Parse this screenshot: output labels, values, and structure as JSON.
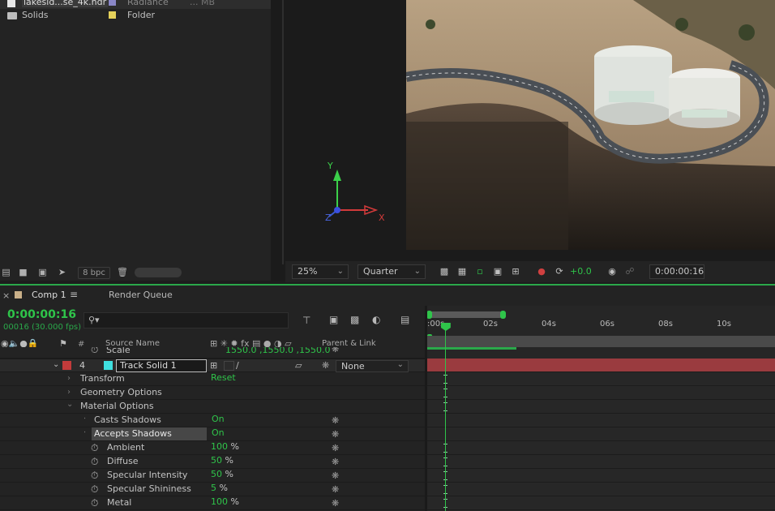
{
  "project": {
    "items": [
      {
        "name": "lakesid...se_4k.hdr",
        "type": "Radiance",
        "size": "... MB",
        "label_color": "#8a87c7"
      },
      {
        "name": "Solids",
        "type": "Folder",
        "size": "",
        "label_color": "#e5d15a"
      }
    ],
    "bpc": "8 bpc"
  },
  "viewer": {
    "magnification": "25%",
    "resolution": "Quarter",
    "exposure": "+0.0",
    "timecode": "0:00:00:16",
    "axes": {
      "x": "X",
      "y": "Y",
      "z": "Z"
    }
  },
  "timeline": {
    "tabs": [
      {
        "label": "Comp 1",
        "active": true
      },
      {
        "label": "Render Queue",
        "active": false
      }
    ],
    "current_time": "0:00:00:16",
    "frame_info": "00016 (30.000 fps)",
    "search_placeholder": "",
    "columns": {
      "num": "#",
      "source_name": "Source Name",
      "parent_link": "Parent & Link"
    },
    "ruler_ticks": [
      ":00s",
      "02s",
      "04s",
      "06s",
      "08s",
      "10s"
    ],
    "playhead_fraction": 0.0533,
    "scale_row": {
      "label": "Scale",
      "value": "1550.0 ,1550.0 ,1550.0"
    },
    "layer": {
      "number": "4",
      "name": "Track Solid 1",
      "parent": "None",
      "label_color": "#c33b3b",
      "swatch_color": "#3fe0e0"
    },
    "groups": [
      {
        "label": "Transform",
        "value": "Reset"
      },
      {
        "label": "Geometry Options",
        "value": ""
      },
      {
        "label": "Material Options",
        "value": ""
      }
    ],
    "properties": [
      {
        "label": "Casts Shadows",
        "value": "On",
        "unit": "",
        "stopwatch": false,
        "selected": false
      },
      {
        "label": "Accepts Shadows",
        "value": "On",
        "unit": "",
        "stopwatch": false,
        "selected": true
      },
      {
        "label": "Ambient",
        "value": "100",
        "unit": "%",
        "stopwatch": true,
        "selected": false
      },
      {
        "label": "Diffuse",
        "value": "50",
        "unit": "%",
        "stopwatch": true,
        "selected": false
      },
      {
        "label": "Specular Intensity",
        "value": "50",
        "unit": "%",
        "stopwatch": true,
        "selected": false
      },
      {
        "label": "Specular Shininess",
        "value": "5",
        "unit": "%",
        "stopwatch": true,
        "selected": false
      },
      {
        "label": "Metal",
        "value": "100",
        "unit": "%",
        "stopwatch": true,
        "selected": false
      }
    ],
    "accent_color": "#2aa84a"
  }
}
